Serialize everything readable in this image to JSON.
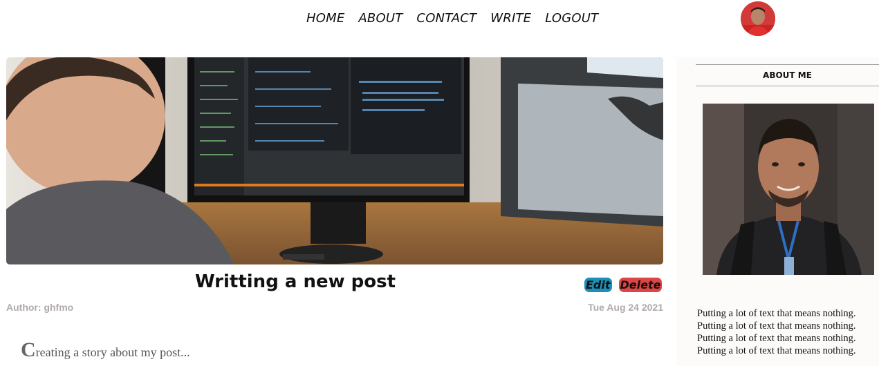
{
  "nav": {
    "items": [
      {
        "label": "HOME"
      },
      {
        "label": "ABOUT"
      },
      {
        "label": "CONTACT"
      },
      {
        "label": "WRITE"
      },
      {
        "label": "LOGOUT"
      }
    ]
  },
  "post": {
    "title": "Writting a new post",
    "edit_label": "Edit",
    "delete_label": "Delete",
    "author": "Author: ghfmo",
    "date": "Tue Aug 24 2021",
    "story_first_letter": "C",
    "story_rest": "reating a story about my post..."
  },
  "sidebar": {
    "title": "ABOUT ME",
    "lines": [
      "Putting a lot of text that means nothing.",
      "Putting a lot of text that means nothing.",
      "Putting a lot of text that means nothing.",
      "Putting a lot of text that means nothing."
    ]
  },
  "colors": {
    "edit_button": "#1b8fb8",
    "delete_button": "#e04545",
    "meta_text": "#b0a9a9",
    "sidebar_bg": "#fdfafa"
  }
}
